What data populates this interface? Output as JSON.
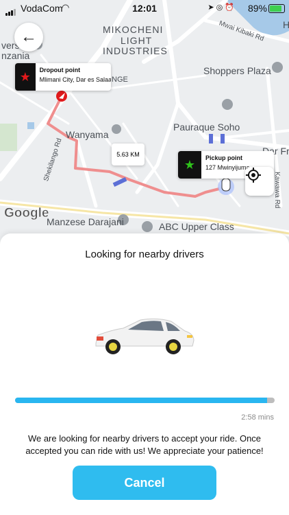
{
  "status_bar": {
    "carrier": "VodaCom",
    "time": "12:01",
    "battery": "89%"
  },
  "map": {
    "labels": {
      "mikocheni": "MIKOCHENI",
      "light": "LIGHT",
      "industries": "INDUSTRIES",
      "mwai_kibaki": "Mwai Kibaki Rd",
      "shoppers": "Shoppers Plaza",
      "pauraque": "Pauraque Soho",
      "wanyama": "Wanyama",
      "dar_fre": "Dar Fre",
      "shekilango": "Shekilango Rd",
      "kawawa": "Kawawa Rd",
      "manzese": "Manzese Darajani",
      "abc": "ABC Upper Class",
      "versi": "versi",
      "nzania": "nzania",
      "nge": "NGE",
      "h": "H"
    },
    "dropout_card": {
      "title": "Dropout point",
      "address": "Mlimani City, Dar es Salaam"
    },
    "pickup_card": {
      "title": "Pickup point",
      "address": "127 Mwinyijuma"
    },
    "distance": "5.63 KM",
    "google_logo": "Google",
    "colors": {
      "route": "#ef8e8e",
      "dropout_star": "#e0191b",
      "pickup_star": "#2fc21b"
    }
  },
  "sheet": {
    "title": "Looking for nearby drivers",
    "eta": "2:58 mins",
    "progress": 0.97,
    "message": "We are looking for nearby drivers to accept your ride. Once accepted you can ride with us! We appreciate your patience!",
    "cancel_label": "Cancel",
    "accent": "#2fbcef"
  }
}
